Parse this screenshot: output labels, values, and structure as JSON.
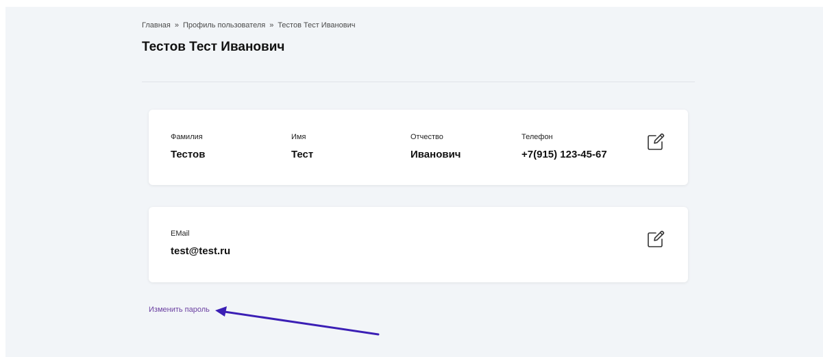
{
  "breadcrumb": {
    "items": [
      "Главная",
      "Профиль пользователя",
      "Тестов Тест Иванович"
    ],
    "separator": "»"
  },
  "page": {
    "title": "Тестов Тест Иванович"
  },
  "personal_card": {
    "fields": [
      {
        "label": "Фамилия",
        "value": "Тестов"
      },
      {
        "label": "Имя",
        "value": "Тест"
      },
      {
        "label": "Отчество",
        "value": "Иванович"
      },
      {
        "label": "Телефон",
        "value": "+7(915) 123-45-67"
      }
    ],
    "edit_icon": "edit-icon"
  },
  "contact_card": {
    "fields": [
      {
        "label": "EMail",
        "value": "test@test.ru"
      }
    ],
    "edit_icon": "edit-icon"
  },
  "links": {
    "change_password": "Изменить пароль"
  },
  "colors": {
    "page_background": "#f2f5f8",
    "card_background": "#ffffff",
    "link": "#6a3fa0",
    "annotation_arrow": "#3b1fb5"
  }
}
